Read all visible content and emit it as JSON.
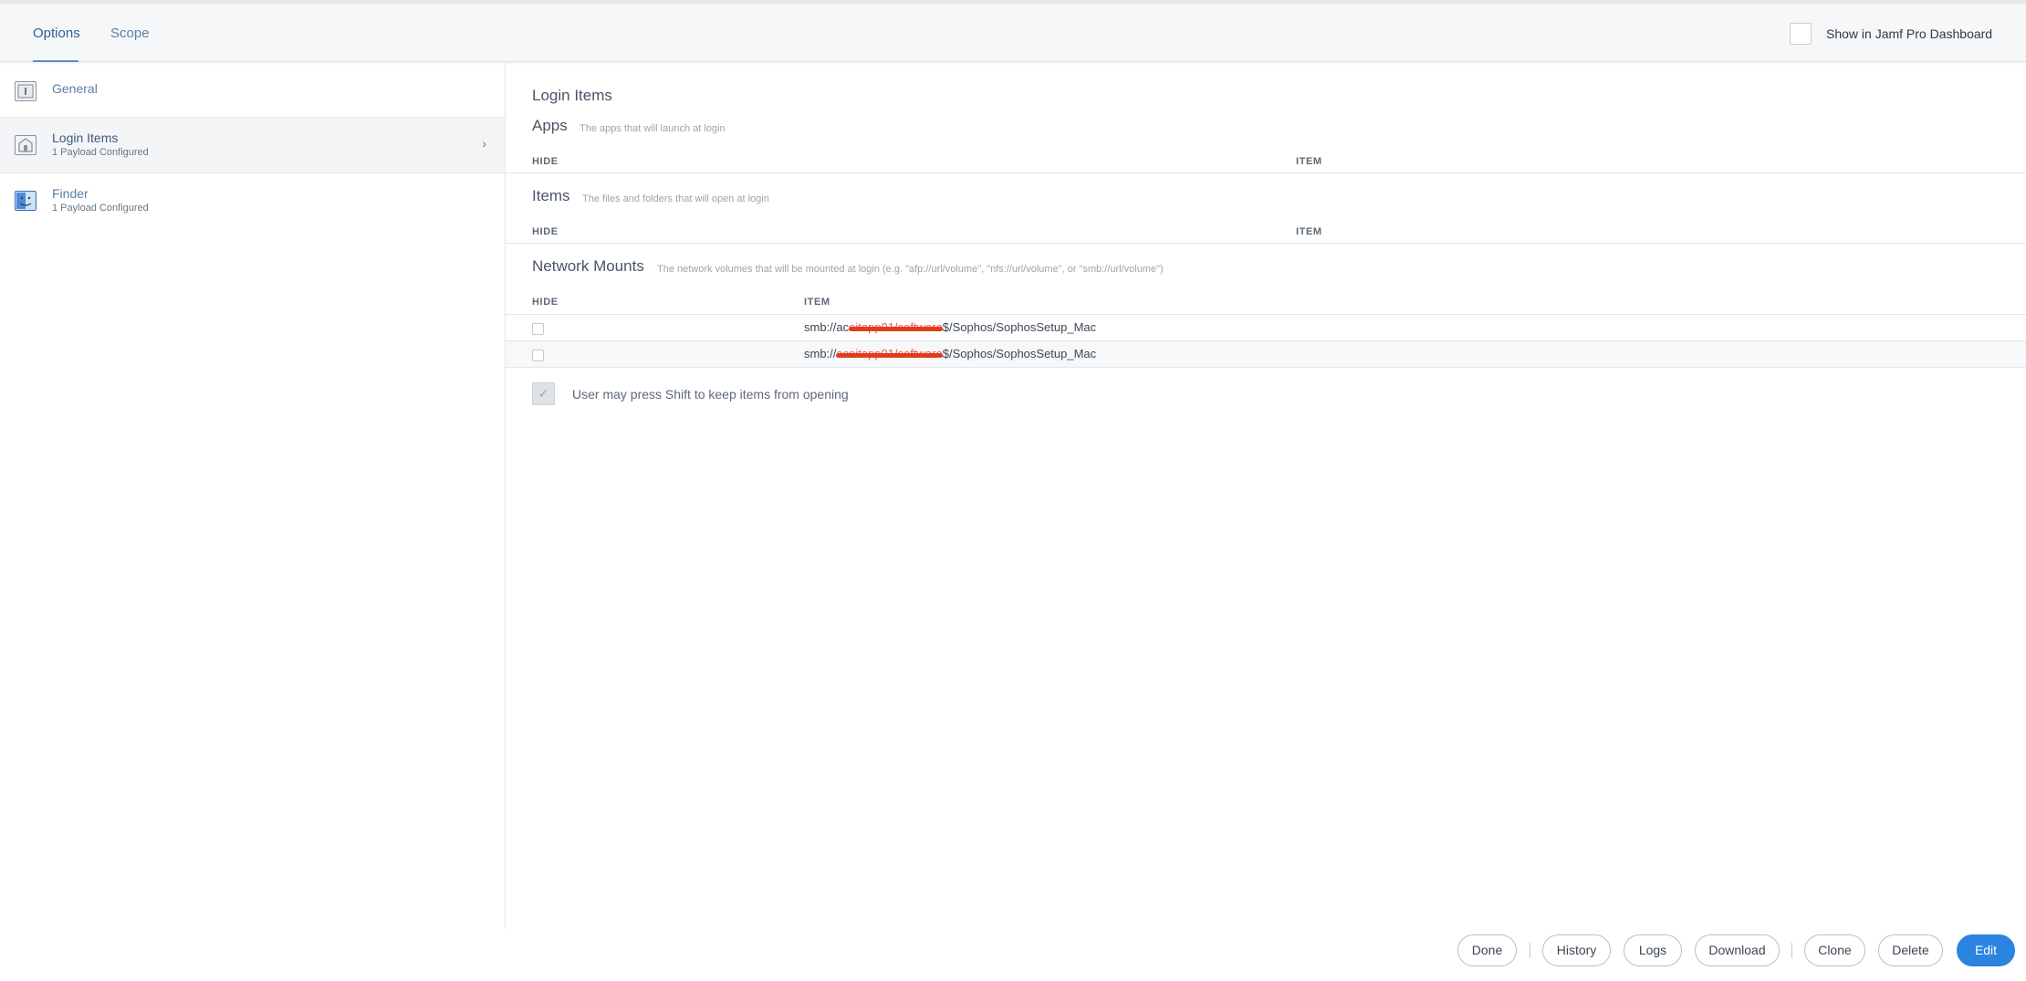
{
  "header": {
    "tabs": [
      {
        "label": "Options"
      },
      {
        "label": "Scope"
      }
    ],
    "dashboard_label": "Show in Jamf Pro Dashboard"
  },
  "sidebar": {
    "items": [
      {
        "title": "General",
        "subtitle": ""
      },
      {
        "title": "Login Items",
        "subtitle": "1 Payload Configured"
      },
      {
        "title": "Finder",
        "subtitle": "1 Payload Configured"
      }
    ]
  },
  "main": {
    "title": "Login Items",
    "apps": {
      "title": "Apps",
      "desc": "The apps that will launch at login",
      "col_hide": "HIDE",
      "col_item": "ITEM"
    },
    "items": {
      "title": "Items",
      "desc": "The files and folders that will open at login",
      "col_hide": "HIDE",
      "col_item": "ITEM"
    },
    "network": {
      "title": "Network Mounts",
      "desc": "The network volumes that will be mounted at login (e.g. \"afp://url/volume\", \"nfs://url/volume\", or \"smb://url/volume\")",
      "col_hide": "HIDE",
      "col_item": "ITEM",
      "rows": [
        {
          "prefix": "smb://ac",
          "redacted": "eitapp01/software",
          "suffix": "$/Sophos/SophosSetup_Mac"
        },
        {
          "prefix": "smb://",
          "redacted": "aceitapp01/software",
          "suffix": "$/Sophos/SophosSetup_Mac"
        }
      ]
    },
    "shift_label": "User may press Shift to keep items from opening"
  },
  "footer": {
    "done": "Done",
    "history": "History",
    "logs": "Logs",
    "download": "Download",
    "clone": "Clone",
    "delete": "Delete",
    "edit": "Edit"
  },
  "colors": {
    "accent": "#2a84e0",
    "link": "#5b7fa8",
    "redaction": "#e23a1f"
  }
}
